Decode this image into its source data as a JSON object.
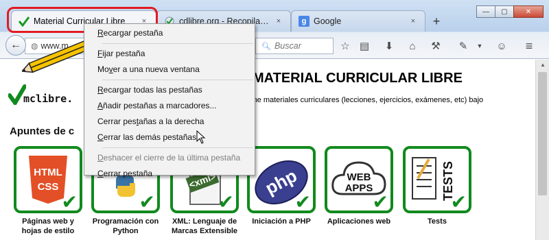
{
  "window": {
    "min": "—",
    "max": "▢",
    "close": "✕"
  },
  "tabs": [
    {
      "label": "Material Curricular Libre",
      "favicon": "green-check-icon",
      "close": "×"
    },
    {
      "label": "cdlibre.org - Recopilacion",
      "favicon": "cdlibre-icon",
      "close": "×"
    },
    {
      "label": "Google",
      "favicon": "google-icon",
      "close": "×"
    }
  ],
  "new_tab": "+",
  "navbar": {
    "url": "www.m",
    "search_placeholder": "Buscar"
  },
  "page": {
    "logo_text": "mclibre.",
    "title": "MATERIAL CURRICULAR LIBRE",
    "description": "b contiene materiales curriculares (lecciones, ejercicios, exámenes, etc) bajo",
    "section": "Apuntes de c",
    "cards": [
      {
        "icon": "html-css-icon",
        "caption": "Páginas web y hojas de estilo",
        "art": "HTML\nCSS"
      },
      {
        "icon": "python-icon",
        "caption": "Programación con Python",
        "art": "python"
      },
      {
        "icon": "xml-icon",
        "caption": "XML: Lenguaje de Marcas Extensible",
        "art": "<xml>"
      },
      {
        "icon": "php-icon",
        "caption": "Iniciación a PHP",
        "art": "php"
      },
      {
        "icon": "web-apps-icon",
        "caption": "Aplicaciones web",
        "art": "WEB\nAPPS"
      },
      {
        "icon": "tests-icon",
        "caption": "Tests",
        "art": "TESTS"
      }
    ]
  },
  "context_menu": {
    "items": [
      {
        "pre": "",
        "u": "R",
        "post": "ecargar pestaña"
      },
      {
        "sep": true
      },
      {
        "pre": "",
        "u": "F",
        "post": "ijar pestaña"
      },
      {
        "pre": "Mo",
        "u": "v",
        "post": "er a una nueva ventana"
      },
      {
        "sep": true
      },
      {
        "pre": "",
        "u": "R",
        "post": "ecargar todas las pestañas"
      },
      {
        "pre": "",
        "u": "A",
        "post": "ñadir pestañas a marcadores..."
      },
      {
        "pre": "Cerrar pes",
        "u": "t",
        "post": "añas a la derecha"
      },
      {
        "pre": "",
        "u": "C",
        "post": "errar las demás pestañas"
      },
      {
        "sep": true
      },
      {
        "pre": "",
        "u": "D",
        "post": "eshacer el cierre de la última pestaña",
        "disabled": true
      },
      {
        "pre": "",
        "u": "C",
        "post": "errar pestaña"
      }
    ]
  },
  "colors": {
    "accent_green": "#118a1e",
    "highlight_red": "#e11a22"
  }
}
